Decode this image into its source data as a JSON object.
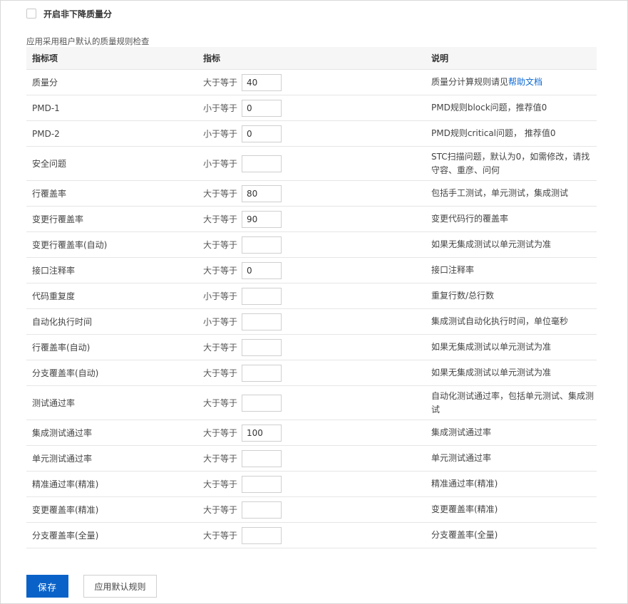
{
  "toggle": {
    "label": "开启非下降质量分",
    "checked": false
  },
  "note": "应用采用租户默认的质量规则检查",
  "table": {
    "headers": [
      "指标项",
      "指标",
      "说明"
    ],
    "rows": [
      {
        "item": "质量分",
        "op": "大于等于",
        "value": "40",
        "desc": "质量分计算规则请见",
        "link": "帮助文档",
        "tall": false
      },
      {
        "item": "PMD-1",
        "op": "小于等于",
        "value": "0",
        "desc": "PMD规则block问题，推荐值0",
        "tall": false
      },
      {
        "item": "PMD-2",
        "op": "小于等于",
        "value": "0",
        "desc": "PMD规则critical问题， 推荐值0",
        "tall": false
      },
      {
        "item": "安全问题",
        "op": "小于等于",
        "value": "",
        "desc": "STC扫描问题，默认为0，如需修改，请找守容、重彦、问何",
        "tall": true
      },
      {
        "item": "行覆盖率",
        "op": "大于等于",
        "value": "80",
        "desc": "包括手工测试，单元测试，集成测试",
        "tall": false
      },
      {
        "item": "变更行覆盖率",
        "op": "大于等于",
        "value": "90",
        "desc": "变更代码行的覆盖率",
        "tall": false
      },
      {
        "item": "变更行覆盖率(自动)",
        "op": "大于等于",
        "value": "",
        "desc": "如果无集成测试以单元测试为准",
        "tall": false
      },
      {
        "item": "接口注释率",
        "op": "大于等于",
        "value": "0",
        "desc": "接口注释率",
        "tall": false
      },
      {
        "item": "代码重复度",
        "op": "小于等于",
        "value": "",
        "desc": "重复行数/总行数",
        "tall": false
      },
      {
        "item": "自动化执行时间",
        "op": "小于等于",
        "value": "",
        "desc": "集成测试自动化执行时间，单位毫秒",
        "tall": false
      },
      {
        "item": "行覆盖率(自动)",
        "op": "大于等于",
        "value": "",
        "desc": "如果无集成测试以单元测试为准",
        "tall": false
      },
      {
        "item": "分支覆盖率(自动)",
        "op": "大于等于",
        "value": "",
        "desc": "如果无集成测试以单元测试为准",
        "tall": false
      },
      {
        "item": "测试通过率",
        "op": "大于等于",
        "value": "",
        "desc": "自动化测试通过率，包括单元测试、集成测试",
        "tall": true
      },
      {
        "item": "集成测试通过率",
        "op": "大于等于",
        "value": "100",
        "desc": "集成测试通过率",
        "tall": false
      },
      {
        "item": "单元测试通过率",
        "op": "大于等于",
        "value": "",
        "desc": "单元测试通过率",
        "tall": false
      },
      {
        "item": "精准通过率(精准)",
        "op": "大于等于",
        "value": "",
        "desc": "精准通过率(精准)",
        "tall": false
      },
      {
        "item": "变更覆盖率(精准)",
        "op": "大于等于",
        "value": "",
        "desc": "变更覆盖率(精准)",
        "tall": false
      },
      {
        "item": "分支覆盖率(全量)",
        "op": "大于等于",
        "value": "",
        "desc": "分支覆盖率(全量)",
        "tall": false
      }
    ]
  },
  "buttons": {
    "save": "保存",
    "apply_default": "应用默认规则"
  },
  "colors": {
    "primary": "#0a62c8",
    "link": "#0c6ad4",
    "header_bg": "#f6f6f6",
    "border": "#e6e6e6"
  }
}
